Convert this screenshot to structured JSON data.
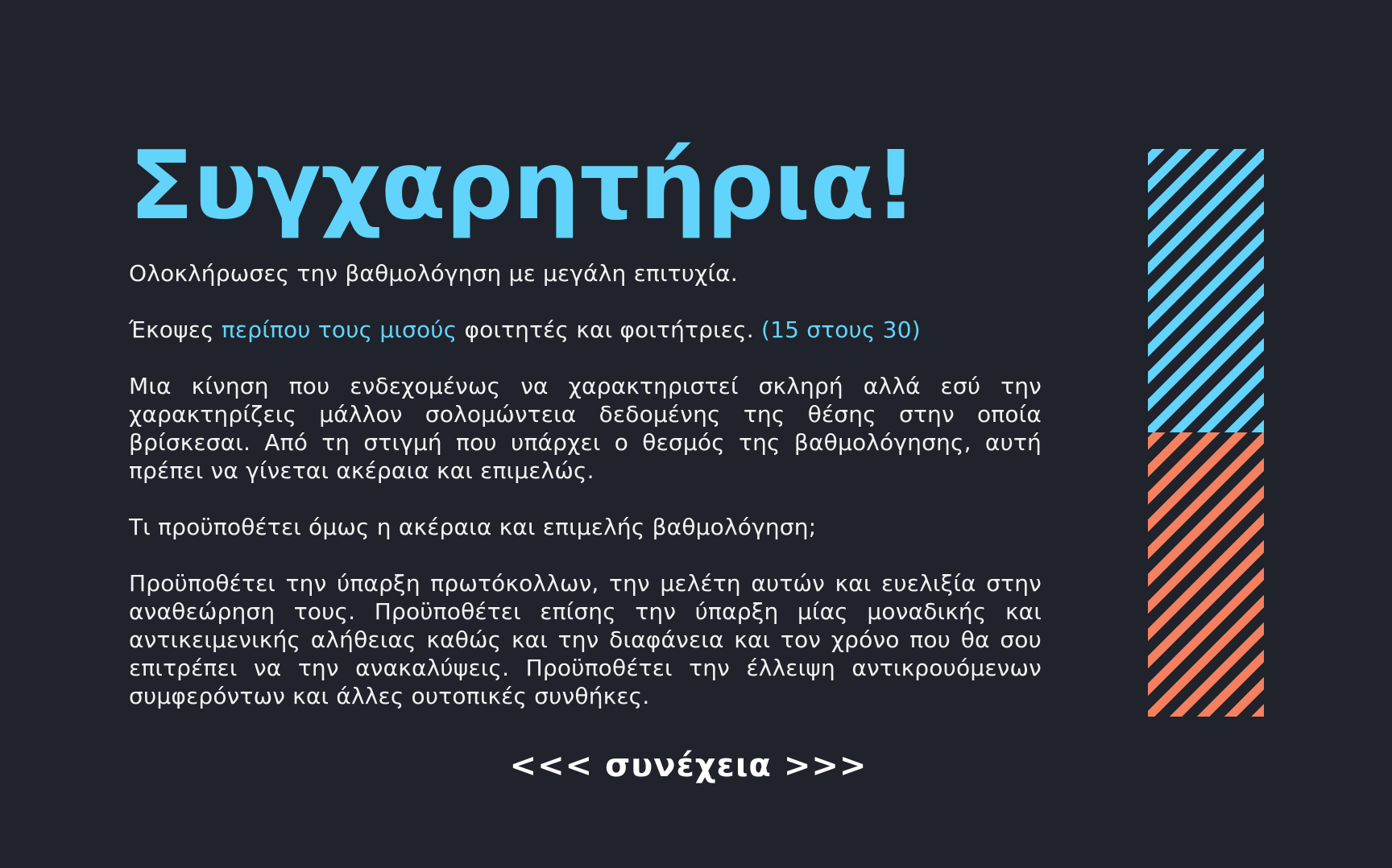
{
  "title": "Συγχαρητήρια!",
  "p1": "Ολοκλήρωσες την βαθμολόγηση με μεγάλη επιτυχία.",
  "p2": {
    "before": "Έκοψες ",
    "highlight": "περίπου τους μισούς",
    "middle": " φοιτητές και φοιτήτριες. ",
    "count": "(15 στους 30)"
  },
  "p3": "Μια κίνηση που ενδεχομένως να χαρακτηριστεί σκληρή αλλά εσύ την χαρακτηρίζεις μάλλον σολομώντεια δεδομένης της θέσης στην οποία βρίσκεσαι. Από τη στιγμή που υπάρχει ο θεσμός της βαθμολόγησης, αυτή πρέπει να γίνεται ακέραια και επιμελώς.",
  "p4": "Τι προϋποθέτει όμως η ακέραια και επιμελής βαθμολόγηση;",
  "p5": "Προϋποθέτει την ύπαρξη πρωτόκολλων, την μελέτη αυτών και ευελιξία στην αναθεώρηση τους. Προϋποθέτει επίσης την ύπαρξη μίας μοναδικής και αντικειμενικής αλήθειας καθώς και την διαφάνεια και τον χρόνο που θα σου επιτρέπει να την ανακαλύψεις. Προϋποθέτει την έλλειψη αντικρουόμενων συμφερόντων και άλλες ουτοπικές συνθήκες.",
  "continue_label": "<<< συνέχεια >>>",
  "colors": {
    "background": "#20232b",
    "accent": "#62d3fb",
    "stripe_bottom": "#f4805f",
    "text": "#f2f2f2"
  }
}
